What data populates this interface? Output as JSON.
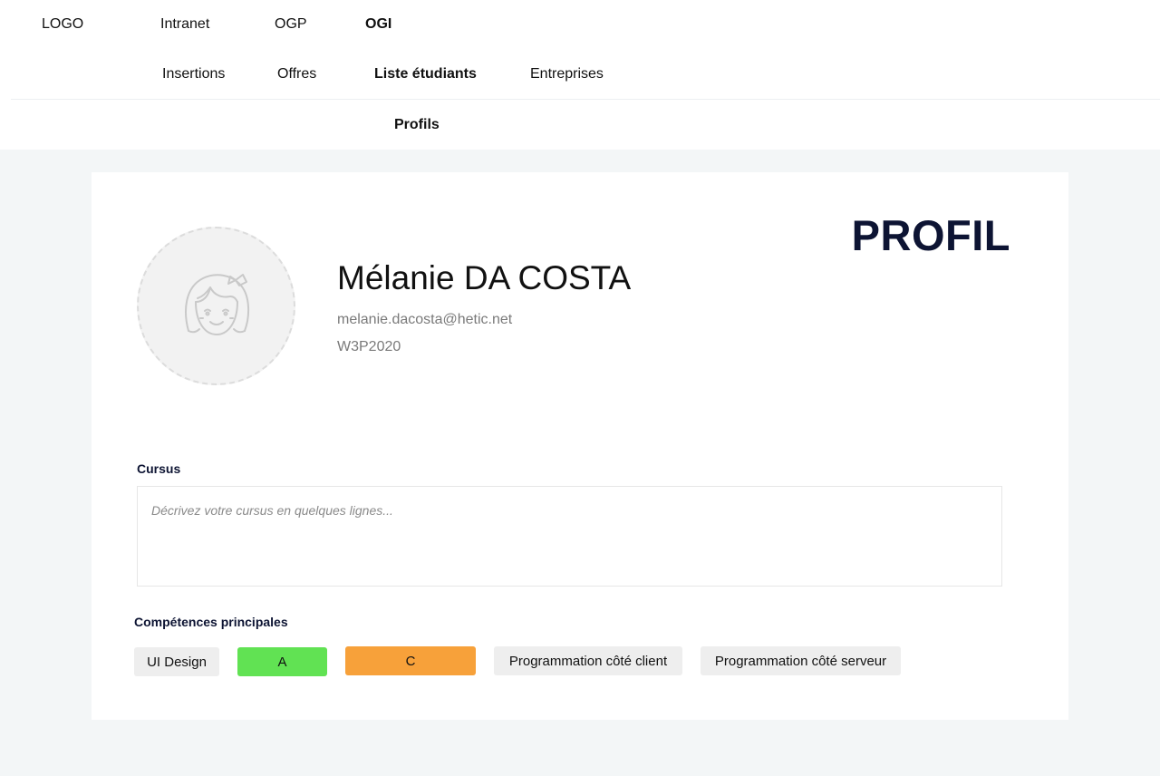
{
  "header": {
    "logo": "LOGO",
    "top_nav": [
      "Intranet",
      "OGP",
      "OGI"
    ],
    "sub_nav": [
      "Insertions",
      "Offres",
      "Liste étudiants",
      "Entreprises"
    ],
    "sub_sub_nav": "Profils"
  },
  "profile": {
    "heading": "PROFIL",
    "name": "Mélanie DA COSTA",
    "email": "melanie.dacosta@hetic.net",
    "promo": "W3P2020",
    "avatar_icon": "girl-avatar-icon"
  },
  "cursus": {
    "label": "Cursus",
    "placeholder": "Décrivez votre cursus en quelques lignes...",
    "value": ""
  },
  "skills": {
    "label": "Compétences principales",
    "items": [
      {
        "label": "UI Design",
        "color": "#eeeeee"
      },
      {
        "label": "A",
        "color": "#61e253"
      },
      {
        "label": "C",
        "color": "#f7a13a"
      },
      {
        "label": "Programmation côté client",
        "color": "#eeeeee"
      },
      {
        "label": "Programmation côté serveur",
        "color": "#eeeeee"
      }
    ]
  },
  "colors": {
    "background": "#f3f6f7",
    "heading": "#0d1433",
    "green": "#61e253",
    "orange": "#f7a13a"
  }
}
